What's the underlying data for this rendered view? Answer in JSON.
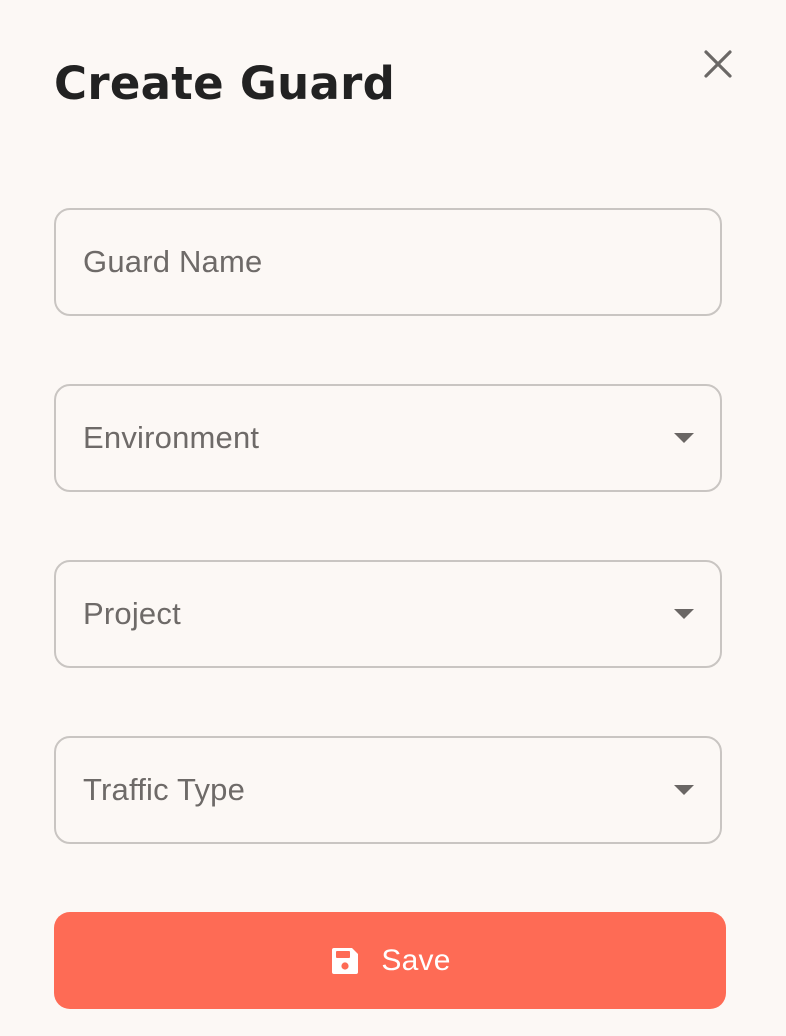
{
  "dialog": {
    "title": "Create Guard",
    "close_icon": "close-icon"
  },
  "form": {
    "guard_name": {
      "label": "Guard Name",
      "value": ""
    },
    "environment": {
      "label": "Environment",
      "value": "",
      "icon": "chevron-down-icon"
    },
    "project": {
      "label": "Project",
      "value": "",
      "icon": "chevron-down-icon"
    },
    "traffic_type": {
      "label": "Traffic Type",
      "value": "",
      "icon": "chevron-down-icon"
    }
  },
  "actions": {
    "save_label": "Save",
    "save_icon": "floppy-disk-icon"
  },
  "colors": {
    "background": "#fcf8f5",
    "accent": "#fe6b55",
    "field_border": "#c9c5c2",
    "title_text": "#222222",
    "label_text": "#6e6a68"
  }
}
